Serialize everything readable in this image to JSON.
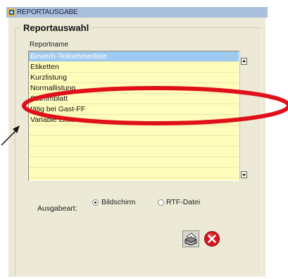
{
  "window": {
    "title": "REPORTAUSGABE"
  },
  "group": {
    "label": "Reportauswahl"
  },
  "list": {
    "header": "Reportname",
    "selected_index": 0,
    "items": [
      "Bewerb-Teilnehmerliste",
      "Etiketten",
      "Kurzlistung",
      "Normallistung",
      "Stammblatt",
      "tätig bei Gast-FF",
      "Variable Liste"
    ],
    "empty_rows": 5
  },
  "output": {
    "label": "Ausgabeart:",
    "options": [
      "Bildschirm",
      "RTF-Datei"
    ],
    "selected": "Bildschirm"
  },
  "buttons": {
    "print_icon": "printer-icon",
    "close_icon": "close-icon"
  },
  "annotation": {
    "ellipse_color": "#e0101a",
    "arrow_color": "#111111"
  },
  "colors": {
    "list_bg": "#fffdbb",
    "selection": "#9ec9f1",
    "title_bar": "#a9bfdc",
    "panel": "#ece9d6"
  }
}
